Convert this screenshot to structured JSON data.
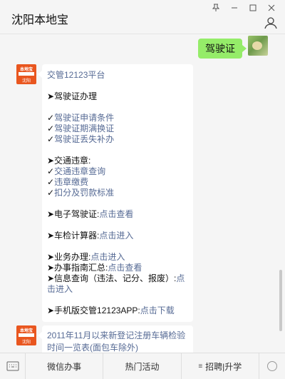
{
  "window": {
    "title": "沈阳本地宝",
    "controls": [
      "pin-icon",
      "minimize-icon",
      "maximize-icon",
      "close-icon"
    ]
  },
  "outgoing": {
    "text": "驾驶证"
  },
  "incoming_avatar": {
    "top_text": "本地宝",
    "bottom_text": "沈阳"
  },
  "message1": {
    "lines": [
      {
        "parts": [
          {
            "text": "交管12123平台",
            "link": true
          }
        ]
      },
      {
        "gap": true
      },
      {
        "parts": [
          {
            "text": "➤驾驶证办理",
            "link": false
          }
        ]
      },
      {
        "gap": true
      },
      {
        "parts": [
          {
            "text": "✓",
            "link": false
          },
          {
            "text": "驾驶证申请条件",
            "link": true
          }
        ]
      },
      {
        "parts": [
          {
            "text": "✓",
            "link": false
          },
          {
            "text": "驾驶证期满换证",
            "link": true
          }
        ]
      },
      {
        "parts": [
          {
            "text": "✓",
            "link": false
          },
          {
            "text": "驾驶证丢失补办",
            "link": true
          }
        ]
      },
      {
        "gap": true
      },
      {
        "parts": [
          {
            "text": "➤交通违章:",
            "link": false
          }
        ]
      },
      {
        "parts": [
          {
            "text": "✓",
            "link": false
          },
          {
            "text": "交通违章查询",
            "link": true
          }
        ]
      },
      {
        "parts": [
          {
            "text": "✓",
            "link": false
          },
          {
            "text": "违章缴费",
            "link": true
          }
        ]
      },
      {
        "parts": [
          {
            "text": "✓",
            "link": false
          },
          {
            "text": "扣分及罚款标准",
            "link": true
          }
        ]
      },
      {
        "gap": true
      },
      {
        "parts": [
          {
            "text": "➤电子驾驶证:",
            "link": false
          },
          {
            "text": "点击查看",
            "link": true
          }
        ]
      },
      {
        "gap": true
      },
      {
        "parts": [
          {
            "text": "➤车检计算器:",
            "link": false
          },
          {
            "text": "点击进入",
            "link": true
          }
        ]
      },
      {
        "gap": true
      },
      {
        "parts": [
          {
            "text": "➤业务办理:",
            "link": false
          },
          {
            "text": "点击进入",
            "link": true
          }
        ]
      },
      {
        "parts": [
          {
            "text": "➤办事指南汇总:",
            "link": false
          },
          {
            "text": "点击查看",
            "link": true
          }
        ]
      },
      {
        "wrap": true,
        "parts": [
          {
            "text": "➤信息查询（违法、记分、报废）:",
            "link": false
          },
          {
            "text": "点击进入",
            "link": true
          }
        ]
      },
      {
        "gap": true
      },
      {
        "parts": [
          {
            "text": "➤手机版交管12123APP:",
            "link": false
          },
          {
            "text": "点击下载",
            "link": true
          }
        ]
      }
    ]
  },
  "message2": {
    "text": "2011年11月以来新登记注册车辆检验时间一览表(面包车除外)"
  },
  "menu": {
    "keyboard_icon": "keyboard-icon",
    "items": [
      "微信办事",
      "热门活动",
      "招聘|升学"
    ]
  }
}
